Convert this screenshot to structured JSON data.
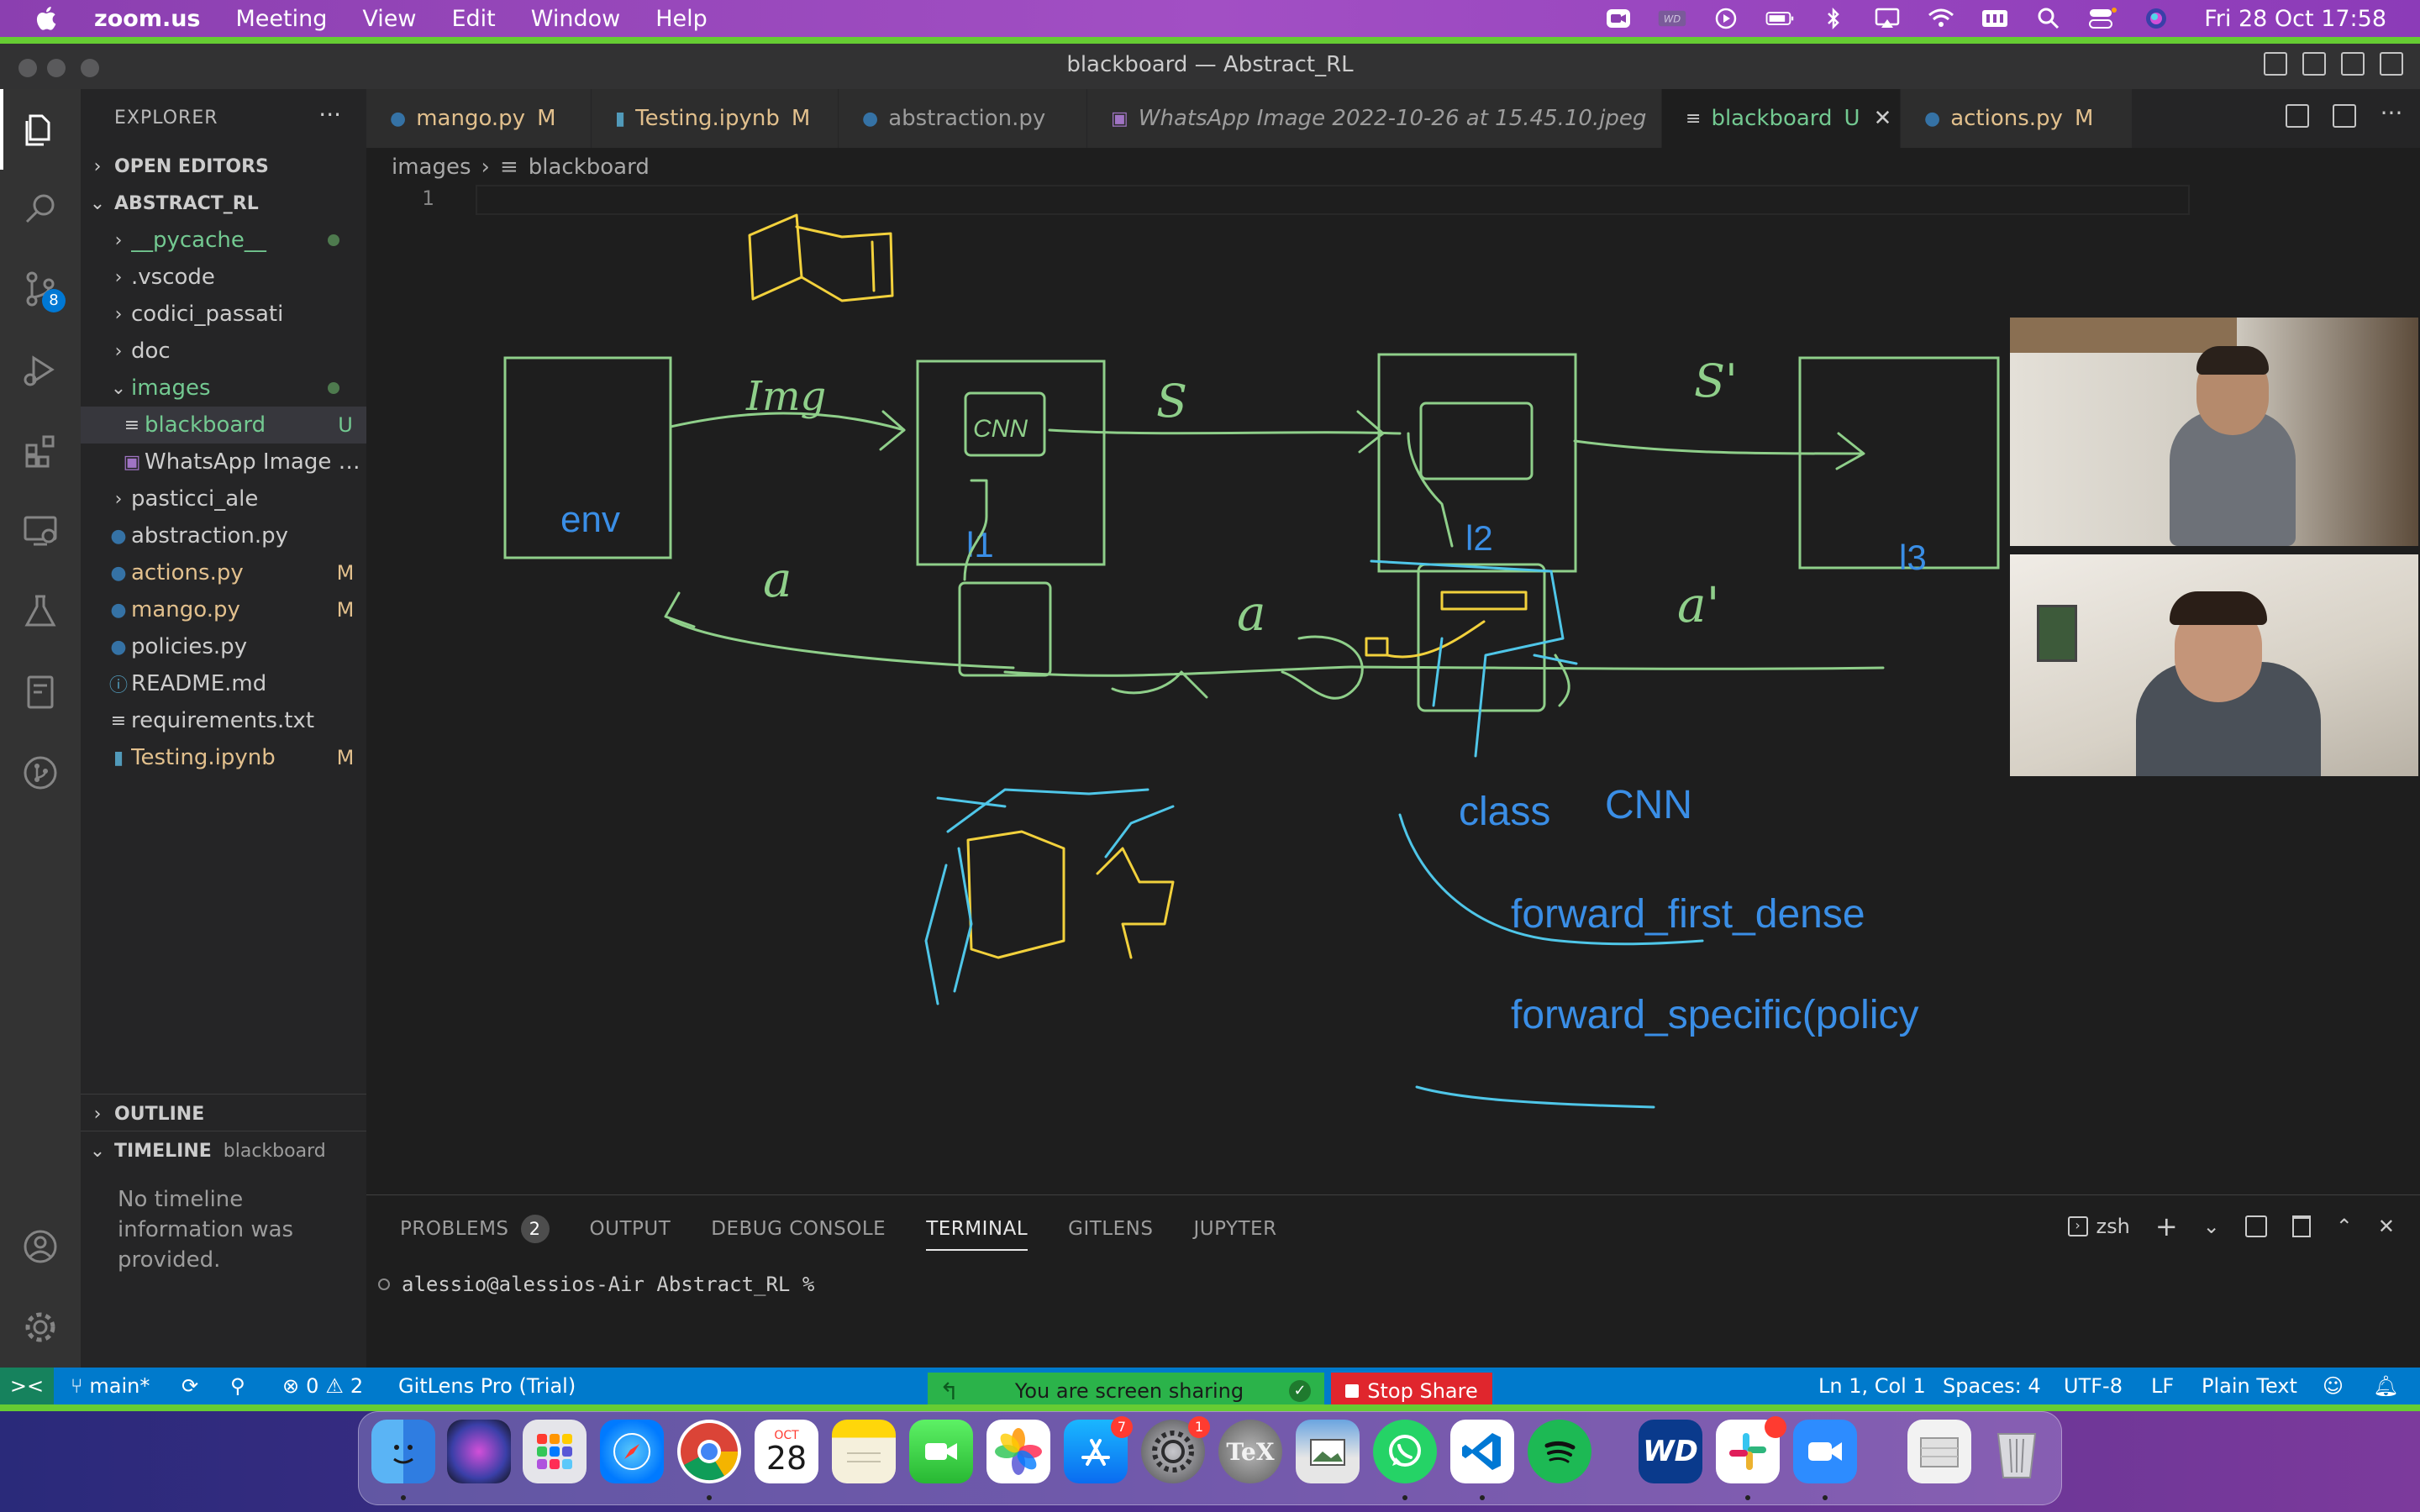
{
  "menubar": {
    "app": "zoom.us",
    "items": [
      "Meeting",
      "View",
      "Edit",
      "Window",
      "Help"
    ],
    "clock": "Fri 28 Oct  17:58",
    "wd_label": "WD"
  },
  "window": {
    "title": "blackboard — Abstract_RL"
  },
  "sidebar": {
    "title": "EXPLORER",
    "more": "···",
    "open_editors": "OPEN EDITORS",
    "project": "ABSTRACT_RL",
    "items": [
      {
        "label": "__pycache__",
        "status": ""
      },
      {
        "label": ".vscode",
        "status": ""
      },
      {
        "label": "codici_passati",
        "status": ""
      },
      {
        "label": "doc",
        "status": ""
      },
      {
        "label": "images",
        "status": ""
      },
      {
        "label": "blackboard",
        "status": "U"
      },
      {
        "label": "WhatsApp Image 2...",
        "status": ""
      },
      {
        "label": "pasticci_ale",
        "status": ""
      },
      {
        "label": "abstraction.py",
        "status": ""
      },
      {
        "label": "actions.py",
        "status": "M"
      },
      {
        "label": "mango.py",
        "status": "M"
      },
      {
        "label": "policies.py",
        "status": ""
      },
      {
        "label": "README.md",
        "status": ""
      },
      {
        "label": "requirements.txt",
        "status": ""
      },
      {
        "label": "Testing.ipynb",
        "status": "M"
      }
    ],
    "outline": "OUTLINE",
    "timeline": "TIMELINE",
    "timeline_file": "blackboard",
    "timeline_msg": "No timeline information was provided."
  },
  "activity": {
    "scm_badge": "8"
  },
  "tabs": [
    {
      "label": "mango.py",
      "status": "M"
    },
    {
      "label": "Testing.ipynb",
      "status": "M"
    },
    {
      "label": "abstraction.py",
      "status": ""
    },
    {
      "label": "WhatsApp Image 2022-10-26 at 15.45.10.jpeg",
      "status": ""
    },
    {
      "label": "blackboard",
      "status": "U"
    },
    {
      "label": "actions.py",
      "status": "M"
    }
  ],
  "breadcrumb": {
    "folder": "images",
    "file": "blackboard"
  },
  "editor": {
    "line": "1"
  },
  "drawing": {
    "boxes": {
      "env": "env",
      "l1": "l1",
      "l2": "l2",
      "l3": "l3"
    },
    "scribbles": {
      "img": "Img",
      "s": "S",
      "s_prime": "S'",
      "a": "a",
      "a2": "a",
      "a_prime": "a'",
      "cnn": "CNN"
    },
    "code": {
      "class_line": "class",
      "cnn": "CNN",
      "first_dense": "forward_first_dense",
      "specific": "forward_specific(policy"
    }
  },
  "panel": {
    "tabs": [
      "PROBLEMS",
      "OUTPUT",
      "DEBUG CONSOLE",
      "TERMINAL",
      "GITLENS",
      "JUPYTER"
    ],
    "problems_count": "2",
    "shell": "zsh",
    "prompt": "alessio@alessios-Air Abstract_RL %"
  },
  "statusbar": {
    "remote": "><",
    "branch": "main*",
    "errors": "0",
    "warnings": "2",
    "gitlens": "GitLens Pro (Trial)",
    "position": "Ln 1, Col 1",
    "spaces": "Spaces: 4",
    "encoding": "UTF-8",
    "eol": "LF",
    "language": "Plain Text"
  },
  "zoom_share": {
    "message": "You are screen sharing",
    "stop": "Stop Share"
  },
  "dock": {
    "calendar_month": "OCT",
    "calendar_day": "28",
    "appstore_badge": "7",
    "settings_badge": "1",
    "tex": "TeX",
    "wd": "WD"
  },
  "colors": {
    "accent": "#007acc",
    "modified": "#e2c08d",
    "untracked": "#73c991",
    "drawing_green": "#8fcf8a",
    "drawing_blue": "#3a8ee6"
  }
}
